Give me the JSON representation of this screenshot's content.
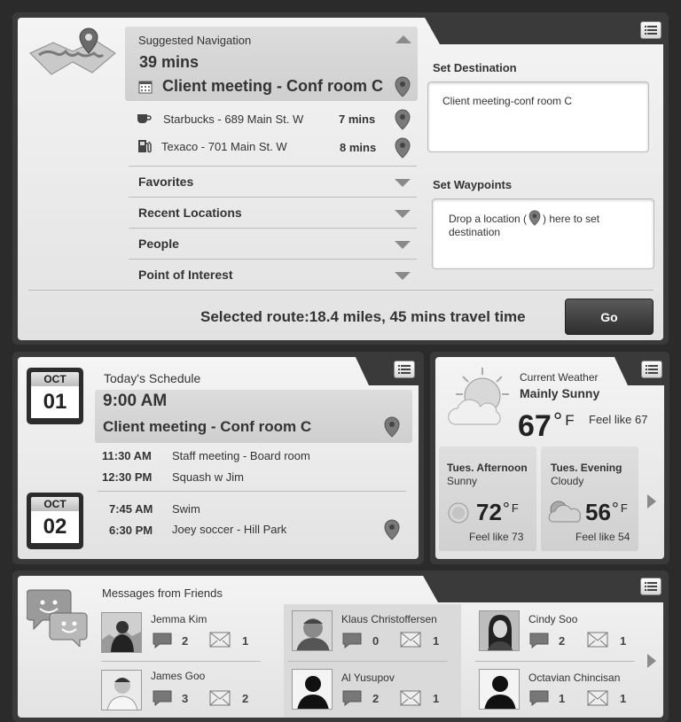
{
  "navigation": {
    "suggested_title": "Suggested Navigation",
    "duration": "39 mins",
    "destination": "Client meeting - Conf room C",
    "stops": [
      {
        "name": "Starbucks - 689 Main St. W",
        "time": "7 mins",
        "icon": "coffee-cup-icon"
      },
      {
        "name": "Texaco - 701 Main St. W",
        "time": "8 mins",
        "icon": "gas-pump-icon"
      }
    ],
    "sections": [
      "Favorites",
      "Recent Locations",
      "People",
      "Point of Interest"
    ],
    "set_destination_label": "Set Destination",
    "destination_input": "Client meeting-conf room C",
    "set_waypoints_label": "Set Waypoints",
    "waypoints_hint_before": "Drop a location (",
    "waypoints_hint_after": ") here to set destination",
    "route_summary": "Selected route:18.4 miles, 45 mins travel time",
    "go_label": "Go"
  },
  "schedule": {
    "title": "Today's Schedule",
    "day1": {
      "month": "OCT",
      "day": "01"
    },
    "day2": {
      "month": "OCT",
      "day": "02"
    },
    "highlight": {
      "time": "9:00 AM",
      "event": "Client meeting - Conf room C"
    },
    "items_day1": [
      {
        "time": "11:30 AM",
        "event": "Staff meeting - Board room"
      },
      {
        "time": "12:30 PM",
        "event": "Squash w Jim"
      }
    ],
    "items_day2": [
      {
        "time": "7:45 AM",
        "event": "Swim"
      },
      {
        "time": "6:30 PM",
        "event": "Joey soccer - Hill Park"
      }
    ]
  },
  "weather": {
    "title": "Current Weather",
    "condition": "Mainly Sunny",
    "temp": "67",
    "unit": "°",
    "unit_letter": "F",
    "feels": "Feel like 67",
    "forecasts": [
      {
        "period": "Tues. Afternoon",
        "condition": "Sunny",
        "temp": "72",
        "unit": "°",
        "unit_letter": "F",
        "feels": "Feel like 73"
      },
      {
        "period": "Tues. Evening",
        "condition": "Cloudy",
        "temp": "56",
        "unit": "°",
        "unit_letter": "F",
        "feels": "Feel like 54"
      }
    ]
  },
  "messages": {
    "title": "Messages from Friends",
    "friends": [
      {
        "name": "Jemma Kim",
        "chats": "2",
        "mails": "1"
      },
      {
        "name": "James Goo",
        "chats": "3",
        "mails": "2"
      },
      {
        "name": "Klaus Christoffersen",
        "chats": "0",
        "mails": "1"
      },
      {
        "name": "Al Yusupov",
        "chats": "2",
        "mails": "1"
      },
      {
        "name": "Cindy Soo",
        "chats": "2",
        "mails": "1"
      },
      {
        "name": "Octavian Chincisan",
        "chats": "1",
        "mails": "1"
      }
    ]
  }
}
